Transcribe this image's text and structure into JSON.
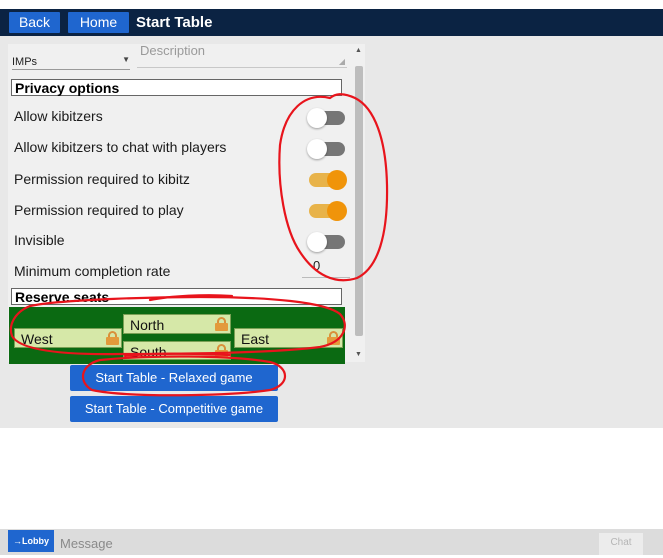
{
  "topbar": {
    "back": "Back",
    "home": "Home",
    "title": "Start Table"
  },
  "form": {
    "scoring": "IMPs",
    "description_placeholder": "Description"
  },
  "privacy": {
    "header": "Privacy options",
    "options": [
      {
        "label": "Allow kibitzers",
        "on": false
      },
      {
        "label": "Allow kibitzers to chat with players",
        "on": false
      },
      {
        "label": "Permission required to kibitz",
        "on": true
      },
      {
        "label": "Permission required to play",
        "on": true
      },
      {
        "label": "Invisible",
        "on": false
      }
    ],
    "min_rate_label": "Minimum completion rate",
    "min_rate_value": "0"
  },
  "reserve": {
    "header": "Reserve seats",
    "north": "North",
    "south": "South",
    "west": "West",
    "east": "East"
  },
  "buttons": {
    "relaxed": "Start Table - Relaxed game",
    "competitive": "Start Table - Competitive game"
  },
  "bottom": {
    "lobby": "→Lobby",
    "message_placeholder": "Message",
    "chat": "Chat"
  },
  "colors": {
    "navbar": "#0b2343",
    "button": "#1f66cf",
    "toggle_on": "#f0940a",
    "seats_bg": "#0b6a12",
    "annotation": "#e8141c"
  }
}
